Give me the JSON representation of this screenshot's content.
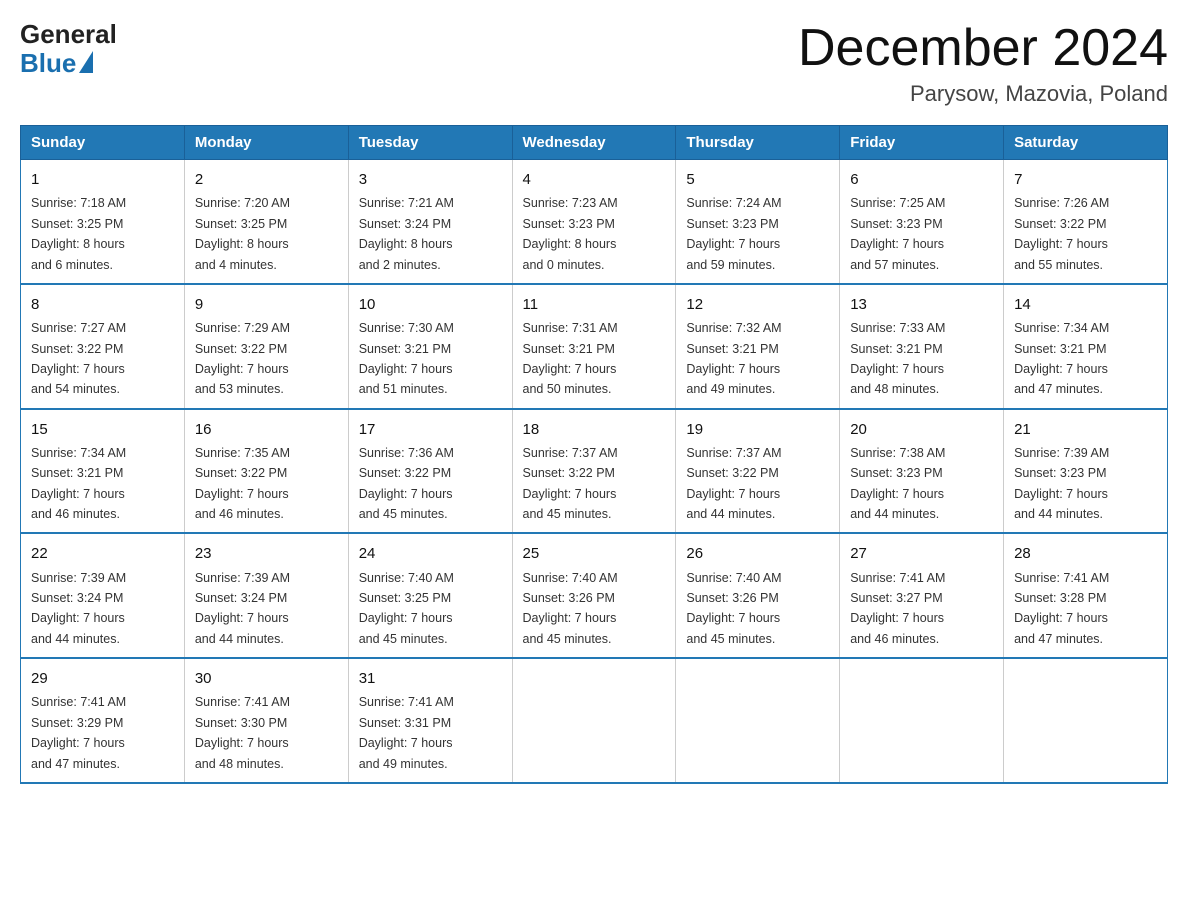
{
  "header": {
    "logo_general": "General",
    "logo_blue": "Blue",
    "month_title": "December 2024",
    "location": "Parysow, Mazovia, Poland"
  },
  "weekdays": [
    "Sunday",
    "Monday",
    "Tuesday",
    "Wednesday",
    "Thursday",
    "Friday",
    "Saturday"
  ],
  "weeks": [
    [
      {
        "day": "1",
        "sunrise": "7:18 AM",
        "sunset": "3:25 PM",
        "daylight": "8 hours and 6 minutes."
      },
      {
        "day": "2",
        "sunrise": "7:20 AM",
        "sunset": "3:25 PM",
        "daylight": "8 hours and 4 minutes."
      },
      {
        "day": "3",
        "sunrise": "7:21 AM",
        "sunset": "3:24 PM",
        "daylight": "8 hours and 2 minutes."
      },
      {
        "day": "4",
        "sunrise": "7:23 AM",
        "sunset": "3:23 PM",
        "daylight": "8 hours and 0 minutes."
      },
      {
        "day": "5",
        "sunrise": "7:24 AM",
        "sunset": "3:23 PM",
        "daylight": "7 hours and 59 minutes."
      },
      {
        "day": "6",
        "sunrise": "7:25 AM",
        "sunset": "3:23 PM",
        "daylight": "7 hours and 57 minutes."
      },
      {
        "day": "7",
        "sunrise": "7:26 AM",
        "sunset": "3:22 PM",
        "daylight": "7 hours and 55 minutes."
      }
    ],
    [
      {
        "day": "8",
        "sunrise": "7:27 AM",
        "sunset": "3:22 PM",
        "daylight": "7 hours and 54 minutes."
      },
      {
        "day": "9",
        "sunrise": "7:29 AM",
        "sunset": "3:22 PM",
        "daylight": "7 hours and 53 minutes."
      },
      {
        "day": "10",
        "sunrise": "7:30 AM",
        "sunset": "3:21 PM",
        "daylight": "7 hours and 51 minutes."
      },
      {
        "day": "11",
        "sunrise": "7:31 AM",
        "sunset": "3:21 PM",
        "daylight": "7 hours and 50 minutes."
      },
      {
        "day": "12",
        "sunrise": "7:32 AM",
        "sunset": "3:21 PM",
        "daylight": "7 hours and 49 minutes."
      },
      {
        "day": "13",
        "sunrise": "7:33 AM",
        "sunset": "3:21 PM",
        "daylight": "7 hours and 48 minutes."
      },
      {
        "day": "14",
        "sunrise": "7:34 AM",
        "sunset": "3:21 PM",
        "daylight": "7 hours and 47 minutes."
      }
    ],
    [
      {
        "day": "15",
        "sunrise": "7:34 AM",
        "sunset": "3:21 PM",
        "daylight": "7 hours and 46 minutes."
      },
      {
        "day": "16",
        "sunrise": "7:35 AM",
        "sunset": "3:22 PM",
        "daylight": "7 hours and 46 minutes."
      },
      {
        "day": "17",
        "sunrise": "7:36 AM",
        "sunset": "3:22 PM",
        "daylight": "7 hours and 45 minutes."
      },
      {
        "day": "18",
        "sunrise": "7:37 AM",
        "sunset": "3:22 PM",
        "daylight": "7 hours and 45 minutes."
      },
      {
        "day": "19",
        "sunrise": "7:37 AM",
        "sunset": "3:22 PM",
        "daylight": "7 hours and 44 minutes."
      },
      {
        "day": "20",
        "sunrise": "7:38 AM",
        "sunset": "3:23 PM",
        "daylight": "7 hours and 44 minutes."
      },
      {
        "day": "21",
        "sunrise": "7:39 AM",
        "sunset": "3:23 PM",
        "daylight": "7 hours and 44 minutes."
      }
    ],
    [
      {
        "day": "22",
        "sunrise": "7:39 AM",
        "sunset": "3:24 PM",
        "daylight": "7 hours and 44 minutes."
      },
      {
        "day": "23",
        "sunrise": "7:39 AM",
        "sunset": "3:24 PM",
        "daylight": "7 hours and 44 minutes."
      },
      {
        "day": "24",
        "sunrise": "7:40 AM",
        "sunset": "3:25 PM",
        "daylight": "7 hours and 45 minutes."
      },
      {
        "day": "25",
        "sunrise": "7:40 AM",
        "sunset": "3:26 PM",
        "daylight": "7 hours and 45 minutes."
      },
      {
        "day": "26",
        "sunrise": "7:40 AM",
        "sunset": "3:26 PM",
        "daylight": "7 hours and 45 minutes."
      },
      {
        "day": "27",
        "sunrise": "7:41 AM",
        "sunset": "3:27 PM",
        "daylight": "7 hours and 46 minutes."
      },
      {
        "day": "28",
        "sunrise": "7:41 AM",
        "sunset": "3:28 PM",
        "daylight": "7 hours and 47 minutes."
      }
    ],
    [
      {
        "day": "29",
        "sunrise": "7:41 AM",
        "sunset": "3:29 PM",
        "daylight": "7 hours and 47 minutes."
      },
      {
        "day": "30",
        "sunrise": "7:41 AM",
        "sunset": "3:30 PM",
        "daylight": "7 hours and 48 minutes."
      },
      {
        "day": "31",
        "sunrise": "7:41 AM",
        "sunset": "3:31 PM",
        "daylight": "7 hours and 49 minutes."
      },
      null,
      null,
      null,
      null
    ]
  ],
  "labels": {
    "sunrise": "Sunrise:",
    "sunset": "Sunset:",
    "daylight": "Daylight:"
  }
}
